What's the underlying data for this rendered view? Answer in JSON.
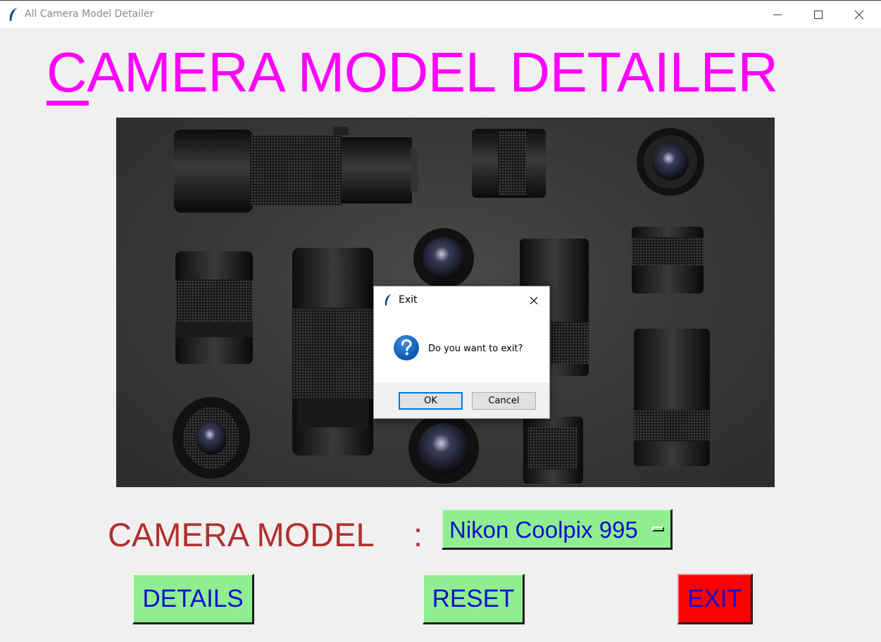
{
  "window": {
    "title": "All Camera Model Detailer",
    "icon": "feather-icon"
  },
  "heading": {
    "first_letter": "C",
    "rest": "AMERA MODEL DETAILER",
    "color": "#ff00ff"
  },
  "banner": {
    "icon": "camera-lenses-photo"
  },
  "model_row": {
    "label": "CAMERA MODEL",
    "colon": ":",
    "selected": "Nikon Coolpix 995",
    "label_color": "#b0302e"
  },
  "buttons": {
    "details": "DETAILS",
    "reset": "RESET",
    "exit": "EXIT",
    "green": "#90ee90",
    "red": "#ff0000",
    "text_color": "#1010cc"
  },
  "dialog": {
    "title": "Exit",
    "message": "Do you want to exit?",
    "ok_label": "OK",
    "cancel_label": "Cancel",
    "icon": "question-icon"
  }
}
